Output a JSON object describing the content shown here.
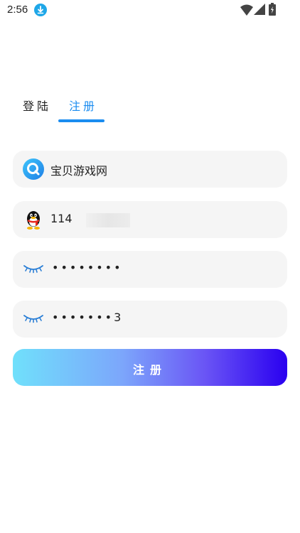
{
  "status_bar": {
    "time": "2:56"
  },
  "tabs": {
    "login_label": "登陆",
    "register_label": "注册",
    "active": "register"
  },
  "form": {
    "site_name": "宝贝游戏网",
    "qq_value": "114",
    "password_value": "••••••••",
    "confirm_password_value": "•••••••3"
  },
  "register_button": {
    "label": "注册"
  },
  "colors": {
    "accent": "#1a8cf0",
    "field_bg": "#f5f5f5",
    "button_gradient_start": "#70e0fb",
    "button_gradient_end": "#2a00f0"
  },
  "icons": {
    "site": "search-logo-icon",
    "qq": "qq-penguin-icon",
    "password": "eye-closed-icon",
    "confirm_password": "eye-closed-icon"
  }
}
